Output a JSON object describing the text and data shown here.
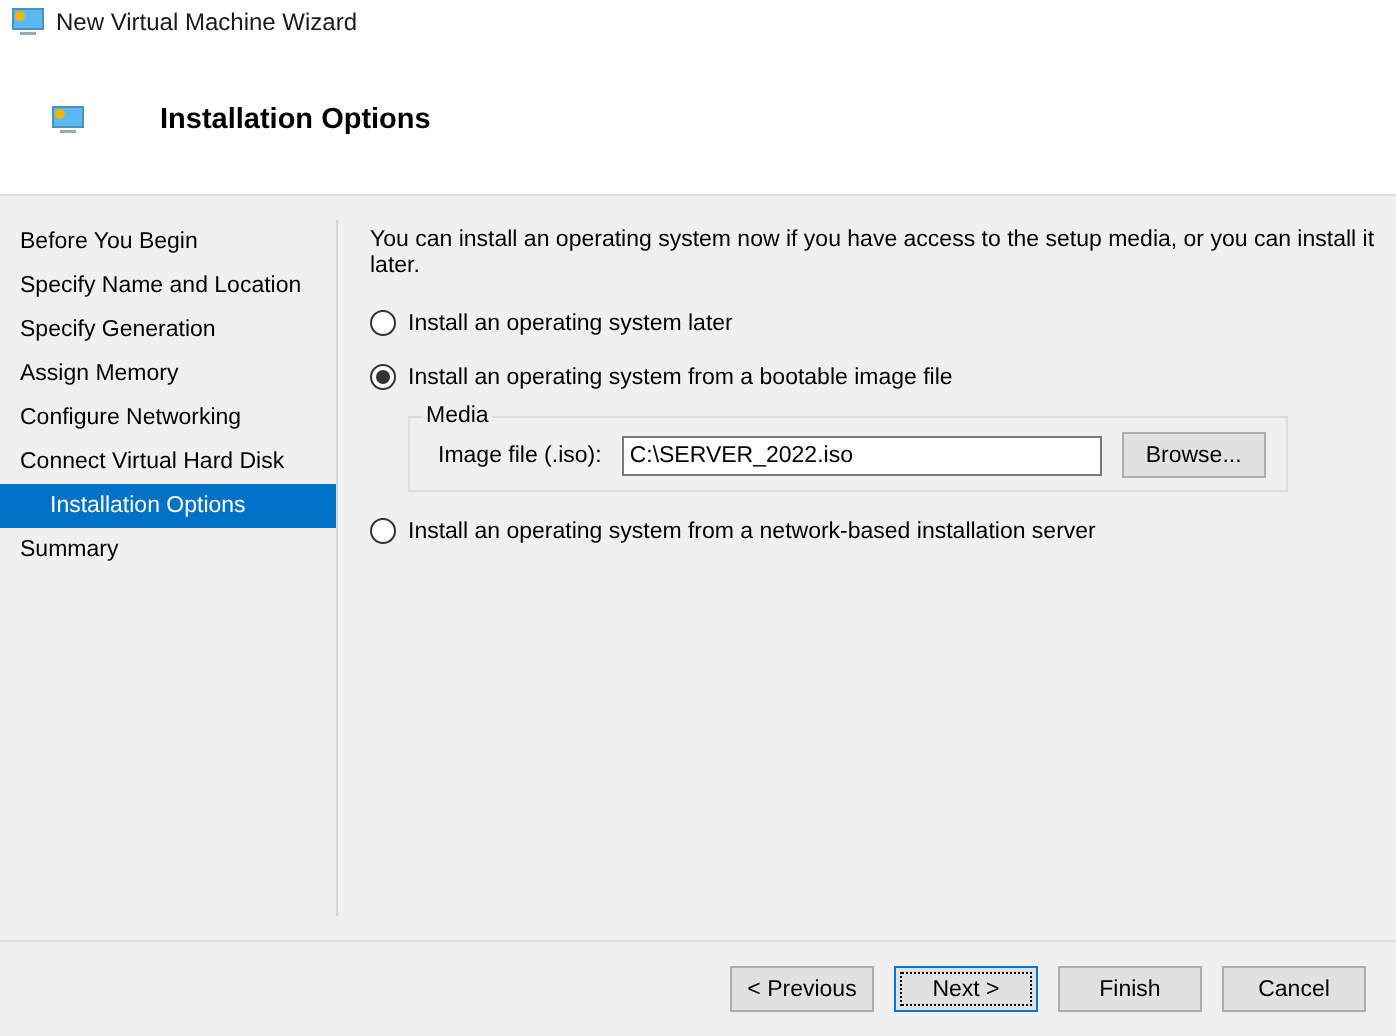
{
  "window": {
    "title": "New Virtual Machine Wizard"
  },
  "header": {
    "title": "Installation Options"
  },
  "steps": [
    {
      "label": "Before You Begin",
      "selected": false
    },
    {
      "label": "Specify Name and Location",
      "selected": false
    },
    {
      "label": "Specify Generation",
      "selected": false
    },
    {
      "label": "Assign Memory",
      "selected": false
    },
    {
      "label": "Configure Networking",
      "selected": false
    },
    {
      "label": "Connect Virtual Hard Disk",
      "selected": false
    },
    {
      "label": "Installation Options",
      "selected": true
    },
    {
      "label": "Summary",
      "selected": false
    }
  ],
  "intro": "You can install an operating system now if you have access to the setup media, or you can install it later.",
  "options": [
    {
      "label": "Install an operating system later",
      "selected": false
    },
    {
      "label": "Install an operating system from a bootable image file",
      "selected": true,
      "media": {
        "legend": "Media",
        "field_label": "Image file (.iso):",
        "value": "C:\\SERVER_2022.iso",
        "browse": "Browse..."
      }
    },
    {
      "label": "Install an operating system from a network-based installation server",
      "selected": false
    }
  ],
  "buttons": [
    {
      "label": "< Previous",
      "default": false
    },
    {
      "label": "Next >",
      "default": true
    },
    {
      "label": "Finish",
      "default": false
    },
    {
      "label": "Cancel",
      "default": false
    }
  ]
}
